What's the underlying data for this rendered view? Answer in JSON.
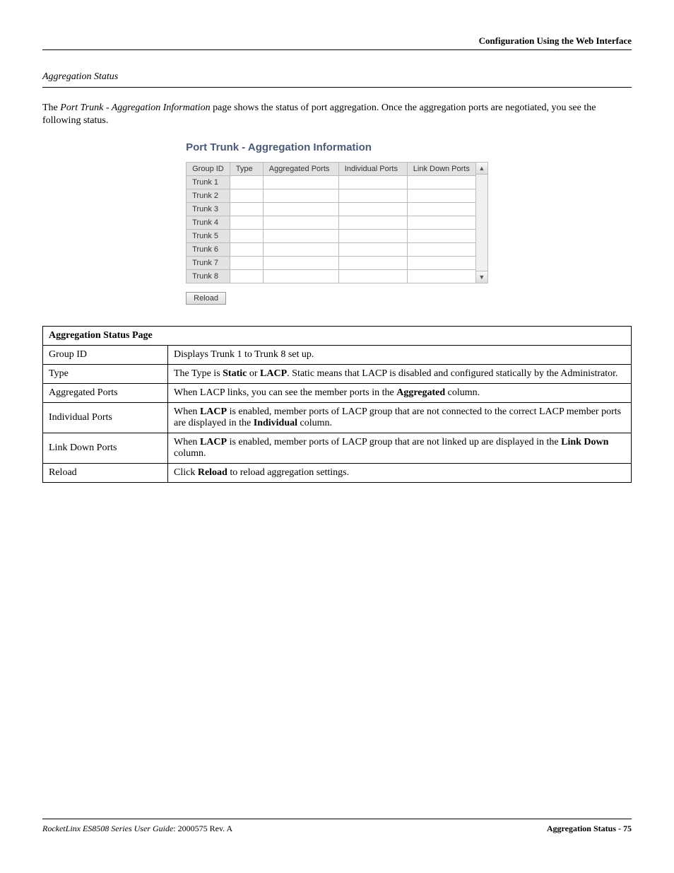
{
  "header": {
    "title": "Configuration Using the Web Interface"
  },
  "section": {
    "title": "Aggregation Status",
    "intro_pre": "The ",
    "intro_italic": "Port Trunk - Aggregation Information",
    "intro_post": " page shows the status of port aggregation. Once the aggregation ports are negotiated, you see the following status."
  },
  "figure": {
    "title": "Port Trunk - Aggregation Information",
    "headers": [
      "Group ID",
      "Type",
      "Aggregated Ports",
      "Individual Ports",
      "Link Down Ports"
    ],
    "rows": [
      "Trunk 1",
      "Trunk 2",
      "Trunk 3",
      "Trunk 4",
      "Trunk 5",
      "Trunk 6",
      "Trunk 7",
      "Trunk 8"
    ],
    "reload_label": "Reload"
  },
  "desc": {
    "caption": "Aggregation Status Page",
    "rows": [
      {
        "label": "Group ID",
        "text_pre": "Displays Trunk 1 to Trunk 8 set up.",
        "b1": "",
        "mid1": "",
        "b2": "",
        "mid2": "",
        "b3": "",
        "post": ""
      },
      {
        "label": "Type",
        "text_pre": "The Type is ",
        "b1": "Static",
        "mid1": " or ",
        "b2": "LACP",
        "mid2": ". Static means that LACP is disabled and configured statically by the Administrator.",
        "b3": "",
        "post": ""
      },
      {
        "label": "Aggregated Ports",
        "text_pre": "When LACP links, you can see the member ports in the ",
        "b1": "Aggregated",
        "mid1": " column.",
        "b2": "",
        "mid2": "",
        "b3": "",
        "post": ""
      },
      {
        "label": "Individual Ports",
        "text_pre": "When ",
        "b1": "LACP",
        "mid1": " is enabled, member ports of LACP group that are not connected to the correct LACP member ports are displayed in the ",
        "b2": "Individual",
        "mid2": " column.",
        "b3": "",
        "post": ""
      },
      {
        "label": "Link Down Ports",
        "text_pre": "When ",
        "b1": "LACP",
        "mid1": " is enabled, member ports of LACP group that are not linked up are displayed in the ",
        "b2": "Link Down",
        "mid2": " column.",
        "b3": "",
        "post": ""
      },
      {
        "label": "Reload",
        "text_pre": "Click ",
        "b1": "Reload",
        "mid1": " to reload aggregation settings.",
        "b2": "",
        "mid2": "",
        "b3": "",
        "post": ""
      }
    ]
  },
  "footer": {
    "left_italic": "RocketLinx ES8508 Series  User Guide",
    "left_plain": ": 2000575 Rev. A",
    "right": "Aggregation Status - 75"
  }
}
